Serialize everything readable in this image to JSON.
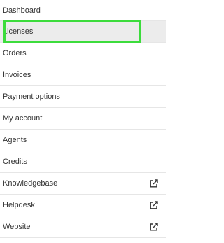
{
  "menu": {
    "items": [
      {
        "id": "dashboard",
        "label": "Dashboard",
        "active": false,
        "external": false
      },
      {
        "id": "licenses",
        "label": "Licenses",
        "active": true,
        "external": false
      },
      {
        "id": "orders",
        "label": "Orders",
        "active": false,
        "external": false
      },
      {
        "id": "invoices",
        "label": "Invoices",
        "active": false,
        "external": false
      },
      {
        "id": "payment-options",
        "label": "Payment options",
        "active": false,
        "external": false
      },
      {
        "id": "my-account",
        "label": "My account",
        "active": false,
        "external": false
      },
      {
        "id": "agents",
        "label": "Agents",
        "active": false,
        "external": false
      },
      {
        "id": "credits",
        "label": "Credits",
        "active": false,
        "external": false
      },
      {
        "id": "knowledgebase",
        "label": "Knowledgebase",
        "active": false,
        "external": true,
        "icon": "external-link-icon"
      },
      {
        "id": "helpdesk",
        "label": "Helpdesk",
        "active": false,
        "external": true,
        "icon": "external-link-icon"
      },
      {
        "id": "website",
        "label": "Website",
        "active": false,
        "external": true,
        "icon": "external-link-icon"
      }
    ]
  },
  "colors": {
    "text": "#333333",
    "active_background": "#ececec",
    "highlight_border": "#3cdc3c",
    "divider": "#e6e6e6"
  }
}
